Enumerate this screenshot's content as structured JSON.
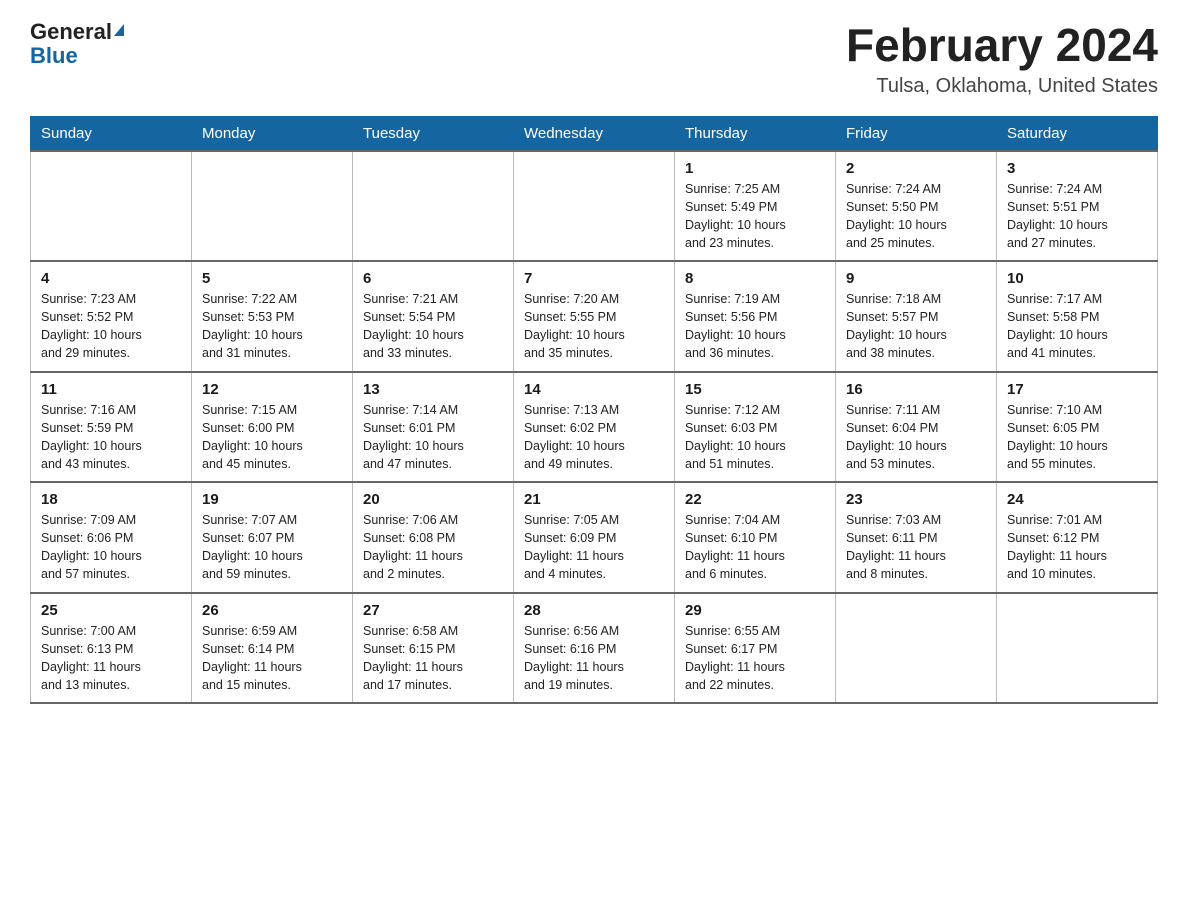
{
  "header": {
    "logo_general": "General",
    "logo_blue": "Blue",
    "month_title": "February 2024",
    "location": "Tulsa, Oklahoma, United States"
  },
  "days_of_week": [
    "Sunday",
    "Monday",
    "Tuesday",
    "Wednesday",
    "Thursday",
    "Friday",
    "Saturday"
  ],
  "weeks": [
    [
      {
        "day": "",
        "info": ""
      },
      {
        "day": "",
        "info": ""
      },
      {
        "day": "",
        "info": ""
      },
      {
        "day": "",
        "info": ""
      },
      {
        "day": "1",
        "info": "Sunrise: 7:25 AM\nSunset: 5:49 PM\nDaylight: 10 hours\nand 23 minutes."
      },
      {
        "day": "2",
        "info": "Sunrise: 7:24 AM\nSunset: 5:50 PM\nDaylight: 10 hours\nand 25 minutes."
      },
      {
        "day": "3",
        "info": "Sunrise: 7:24 AM\nSunset: 5:51 PM\nDaylight: 10 hours\nand 27 minutes."
      }
    ],
    [
      {
        "day": "4",
        "info": "Sunrise: 7:23 AM\nSunset: 5:52 PM\nDaylight: 10 hours\nand 29 minutes."
      },
      {
        "day": "5",
        "info": "Sunrise: 7:22 AM\nSunset: 5:53 PM\nDaylight: 10 hours\nand 31 minutes."
      },
      {
        "day": "6",
        "info": "Sunrise: 7:21 AM\nSunset: 5:54 PM\nDaylight: 10 hours\nand 33 minutes."
      },
      {
        "day": "7",
        "info": "Sunrise: 7:20 AM\nSunset: 5:55 PM\nDaylight: 10 hours\nand 35 minutes."
      },
      {
        "day": "8",
        "info": "Sunrise: 7:19 AM\nSunset: 5:56 PM\nDaylight: 10 hours\nand 36 minutes."
      },
      {
        "day": "9",
        "info": "Sunrise: 7:18 AM\nSunset: 5:57 PM\nDaylight: 10 hours\nand 38 minutes."
      },
      {
        "day": "10",
        "info": "Sunrise: 7:17 AM\nSunset: 5:58 PM\nDaylight: 10 hours\nand 41 minutes."
      }
    ],
    [
      {
        "day": "11",
        "info": "Sunrise: 7:16 AM\nSunset: 5:59 PM\nDaylight: 10 hours\nand 43 minutes."
      },
      {
        "day": "12",
        "info": "Sunrise: 7:15 AM\nSunset: 6:00 PM\nDaylight: 10 hours\nand 45 minutes."
      },
      {
        "day": "13",
        "info": "Sunrise: 7:14 AM\nSunset: 6:01 PM\nDaylight: 10 hours\nand 47 minutes."
      },
      {
        "day": "14",
        "info": "Sunrise: 7:13 AM\nSunset: 6:02 PM\nDaylight: 10 hours\nand 49 minutes."
      },
      {
        "day": "15",
        "info": "Sunrise: 7:12 AM\nSunset: 6:03 PM\nDaylight: 10 hours\nand 51 minutes."
      },
      {
        "day": "16",
        "info": "Sunrise: 7:11 AM\nSunset: 6:04 PM\nDaylight: 10 hours\nand 53 minutes."
      },
      {
        "day": "17",
        "info": "Sunrise: 7:10 AM\nSunset: 6:05 PM\nDaylight: 10 hours\nand 55 minutes."
      }
    ],
    [
      {
        "day": "18",
        "info": "Sunrise: 7:09 AM\nSunset: 6:06 PM\nDaylight: 10 hours\nand 57 minutes."
      },
      {
        "day": "19",
        "info": "Sunrise: 7:07 AM\nSunset: 6:07 PM\nDaylight: 10 hours\nand 59 minutes."
      },
      {
        "day": "20",
        "info": "Sunrise: 7:06 AM\nSunset: 6:08 PM\nDaylight: 11 hours\nand 2 minutes."
      },
      {
        "day": "21",
        "info": "Sunrise: 7:05 AM\nSunset: 6:09 PM\nDaylight: 11 hours\nand 4 minutes."
      },
      {
        "day": "22",
        "info": "Sunrise: 7:04 AM\nSunset: 6:10 PM\nDaylight: 11 hours\nand 6 minutes."
      },
      {
        "day": "23",
        "info": "Sunrise: 7:03 AM\nSunset: 6:11 PM\nDaylight: 11 hours\nand 8 minutes."
      },
      {
        "day": "24",
        "info": "Sunrise: 7:01 AM\nSunset: 6:12 PM\nDaylight: 11 hours\nand 10 minutes."
      }
    ],
    [
      {
        "day": "25",
        "info": "Sunrise: 7:00 AM\nSunset: 6:13 PM\nDaylight: 11 hours\nand 13 minutes."
      },
      {
        "day": "26",
        "info": "Sunrise: 6:59 AM\nSunset: 6:14 PM\nDaylight: 11 hours\nand 15 minutes."
      },
      {
        "day": "27",
        "info": "Sunrise: 6:58 AM\nSunset: 6:15 PM\nDaylight: 11 hours\nand 17 minutes."
      },
      {
        "day": "28",
        "info": "Sunrise: 6:56 AM\nSunset: 6:16 PM\nDaylight: 11 hours\nand 19 minutes."
      },
      {
        "day": "29",
        "info": "Sunrise: 6:55 AM\nSunset: 6:17 PM\nDaylight: 11 hours\nand 22 minutes."
      },
      {
        "day": "",
        "info": ""
      },
      {
        "day": "",
        "info": ""
      }
    ]
  ]
}
